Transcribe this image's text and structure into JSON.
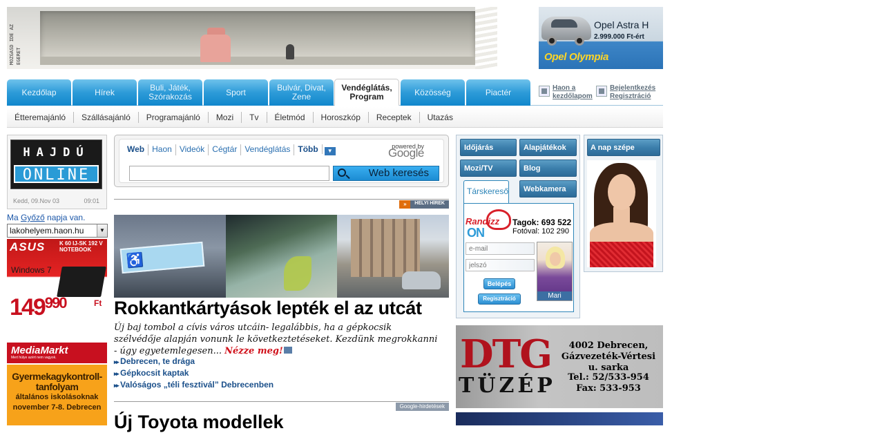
{
  "header": {
    "banner_side_text": "MOZGASD IDE AZ EGERET",
    "opel_ad": {
      "model": "Opel Astra H",
      "price": "2.999.000 Ft-ért",
      "slogan": "Opel Olympia"
    }
  },
  "main_nav": {
    "tabs": [
      {
        "label": "Kezdőlap",
        "active": false
      },
      {
        "label": "Hírek",
        "active": false
      },
      {
        "label": "Buli, Játék, Szórakozás",
        "active": false
      },
      {
        "label": "Sport",
        "active": false
      },
      {
        "label": "Bulvár, Divat, Zene",
        "active": false
      },
      {
        "label": "Vendéglátás, Program",
        "active": true
      },
      {
        "label": "Közösség",
        "active": false
      },
      {
        "label": "Piactér",
        "active": false
      }
    ],
    "homepage_link": "Haon a kezdőlapom",
    "login_link": "Bejelentkezés",
    "register_link": "Regisztráció"
  },
  "sub_nav": {
    "items": [
      "Étteremajánló",
      "Szállásajánló",
      "Programajánló",
      "Mozi",
      "Tv",
      "Életmód",
      "Horoszkóp",
      "Receptek",
      "Utazás"
    ]
  },
  "left": {
    "logo_line1": "HAJDÚ",
    "logo_line2": "ONLINE",
    "date": "Kedd, 09.Nov 03",
    "time": "09:01",
    "nameday_prefix": "Ma ",
    "nameday_name": "Győző",
    "nameday_suffix": " napja van.",
    "site_select_value": "lakohelyem.haon.hu",
    "asus_ad": {
      "brand": "ASUS",
      "model": "K 60 IJ-SK 192 V NOTEBOOK",
      "os": "Windows 7",
      "price_main": "149",
      "price_sup": "990",
      "currency": "Ft",
      "store": "MediaMarkt",
      "store_tagline": "Mert hülye azért nem vagyok."
    },
    "gyermek_ad": {
      "title": "Gyermekagykontroll-tanfolyam",
      "line2": "általános iskolásoknak",
      "line3": "november 7-8. Debrecen"
    }
  },
  "search": {
    "tabs": [
      "Web",
      "Haon",
      "Videók",
      "Cégtár",
      "Vendéglátás",
      "Több"
    ],
    "powered_by": "powered by",
    "google": "Google",
    "button": "Web keresés",
    "input_value": ""
  },
  "section_local": "HELYI HÍREK",
  "section_google": "Google-hirdetések",
  "article": {
    "headline": "Rokkantkártyások lepték el az utcát",
    "lead": "Új baj tombol a cívis város utcáin- legalábbis, ha a gépkocsik szélvédője alapján vonunk le következtetéseket. Kezdünk megrokkanni - úgy egyetemlegesen...",
    "more": "Nézze meg!",
    "related": [
      "Debrecen, te drága",
      "Gépkocsit kaptak",
      "Valóságos „téli fesztivál” Debrecenben"
    ]
  },
  "google_ad_headline": "Új Toyota modellek",
  "widgets": {
    "buttons": [
      "Időjárás",
      "Alapjátékok",
      "Mozi/TV",
      "Blog",
      "Webkamera"
    ],
    "tarskereso": {
      "tab": "Társkereső",
      "brand_top": "Randizz",
      "brand_bottom": "ON",
      "members_label": "Tagok:",
      "members": "693 522",
      "photo_label": "Fotóval:",
      "photo": "102 290",
      "email_placeholder": "e-mail",
      "password_placeholder": "jelszó",
      "login": "Belépés",
      "register": "Regisztráció",
      "profile_name": "Mari"
    },
    "beauty_title": "A nap szépe"
  },
  "dtg_ad": {
    "brand": "DTG",
    "sub": "TÜZÉP",
    "address1": "4002 Debrecen,",
    "address2": "Gázvezeték-Vértesi",
    "address3": "u. sarka",
    "tel": "Tel.: 52/533-954",
    "fax": "Fax: 533-953"
  }
}
